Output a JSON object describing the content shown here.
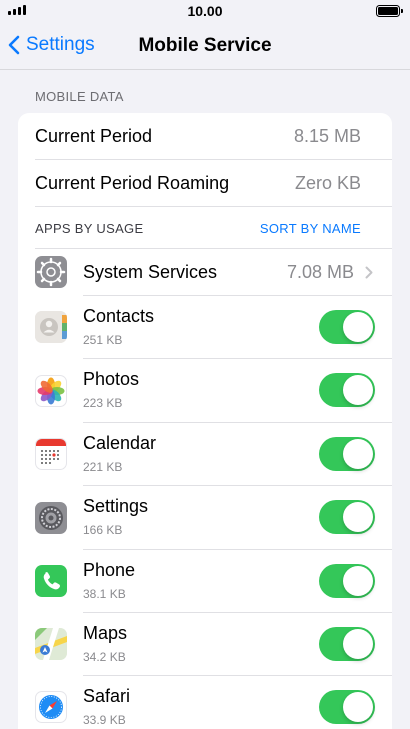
{
  "status_bar": {
    "time": "10.00"
  },
  "nav": {
    "back_label": "Settings",
    "title": "Mobile Service"
  },
  "mobile_data": {
    "header": "MOBILE DATA",
    "current_period": {
      "label": "Current Period",
      "value": "8.15 MB"
    },
    "current_period_roaming": {
      "label": "Current Period Roaming",
      "value": "Zero KB"
    }
  },
  "apps_by_usage": {
    "header": "APPS BY USAGE",
    "sort_label": "SORT BY NAME",
    "system_services": {
      "label": "System Services",
      "value": "7.08 MB"
    },
    "apps": [
      {
        "name": "Contacts",
        "size": "251 KB",
        "icon": "contacts-icon",
        "enabled": true
      },
      {
        "name": "Photos",
        "size": "223 KB",
        "icon": "photos-icon",
        "enabled": true
      },
      {
        "name": "Calendar",
        "size": "221 KB",
        "icon": "calendar-icon",
        "enabled": true
      },
      {
        "name": "Settings",
        "size": "166 KB",
        "icon": "settings-icon",
        "enabled": true
      },
      {
        "name": "Phone",
        "size": "38.1 KB",
        "icon": "phone-icon",
        "enabled": true
      },
      {
        "name": "Maps",
        "size": "34.2 KB",
        "icon": "maps-icon",
        "enabled": true
      },
      {
        "name": "Safari",
        "size": "33.9 KB",
        "icon": "safari-icon",
        "enabled": true
      }
    ]
  },
  "colors": {
    "accent": "#0a7aff",
    "toggle_on": "#34c759",
    "background": "#f2f2f7"
  }
}
